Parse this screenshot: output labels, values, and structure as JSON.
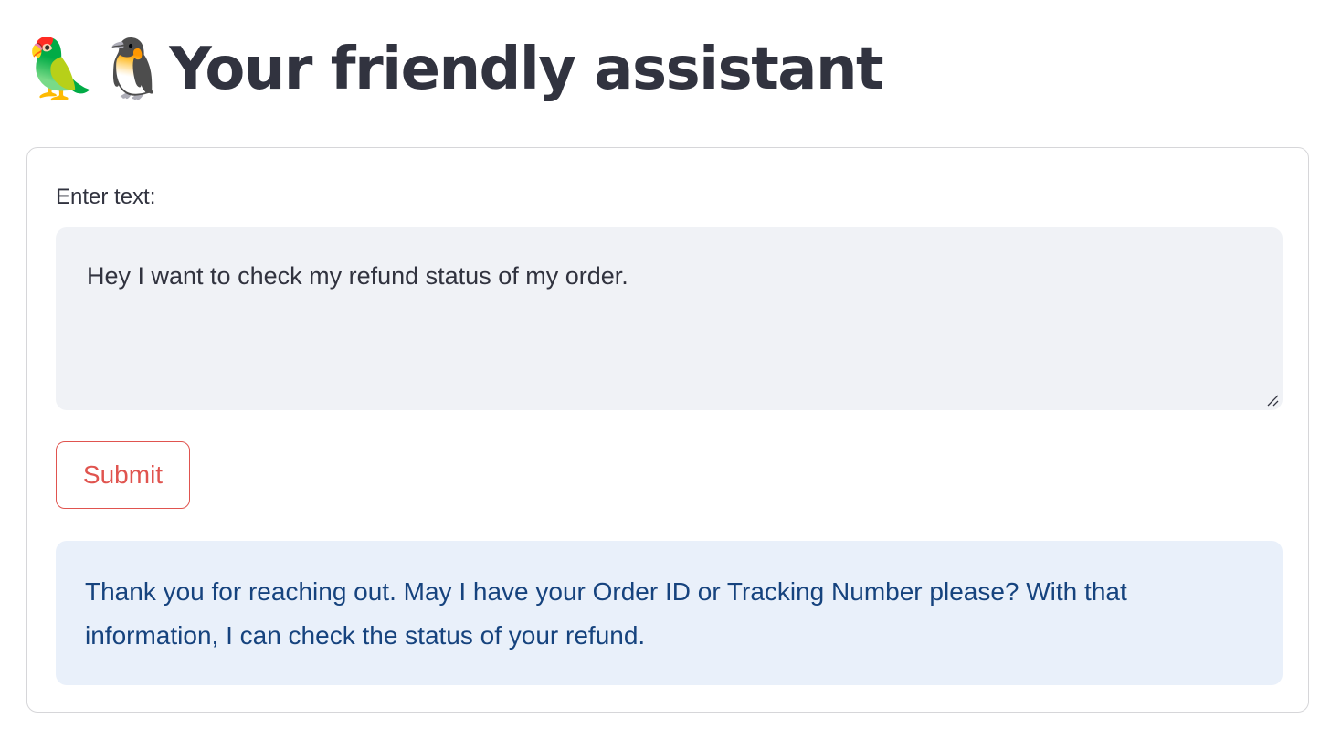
{
  "header": {
    "emoji_1": "🦜",
    "emoji_2": "🐧",
    "title": "Your friendly assistant"
  },
  "form": {
    "input_label": "Enter text:",
    "input_value": "Hey I want to check my refund status of my order.",
    "submit_label": "Submit"
  },
  "response": {
    "text": "Thank you for reaching out. May I have your Order ID or Tracking Number please? With that information, I can check the status of your refund."
  },
  "colors": {
    "title": "#31333f",
    "accent": "#e0544f",
    "textarea_bg": "#f0f2f6",
    "response_bg": "#e9f0fa",
    "response_text": "#16437e"
  },
  "icons": [
    "parrot-icon",
    "penguin-icon",
    "resize-handle-icon"
  ]
}
